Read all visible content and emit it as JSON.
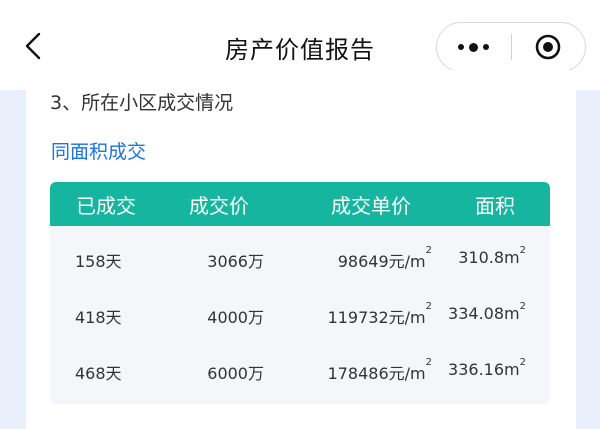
{
  "navbar": {
    "title": "房产价值报告",
    "back_icon": "chevron-left-icon",
    "menu_icon": "more-dots-icon",
    "close_icon": "target-close-icon"
  },
  "section": {
    "title": "3、所在小区成交情况",
    "subtitle": "同面积成交"
  },
  "table": {
    "headers": [
      "已成交",
      "成交价",
      "成交单价",
      "面积"
    ],
    "rows": [
      {
        "days": "158天",
        "price": "3066万",
        "unit_price": "98649元/m",
        "area": "310.8m"
      },
      {
        "days": "418天",
        "price": "4000万",
        "unit_price": "119732元/m",
        "area": "334.08m"
      },
      {
        "days": "468天",
        "price": "6000万",
        "unit_price": "178486元/m",
        "area": "336.16m"
      }
    ],
    "superscript": "2"
  },
  "colors": {
    "header_bg": "#15b5a0",
    "link": "#1a73e8",
    "page_bg": "#e9f0fb"
  }
}
